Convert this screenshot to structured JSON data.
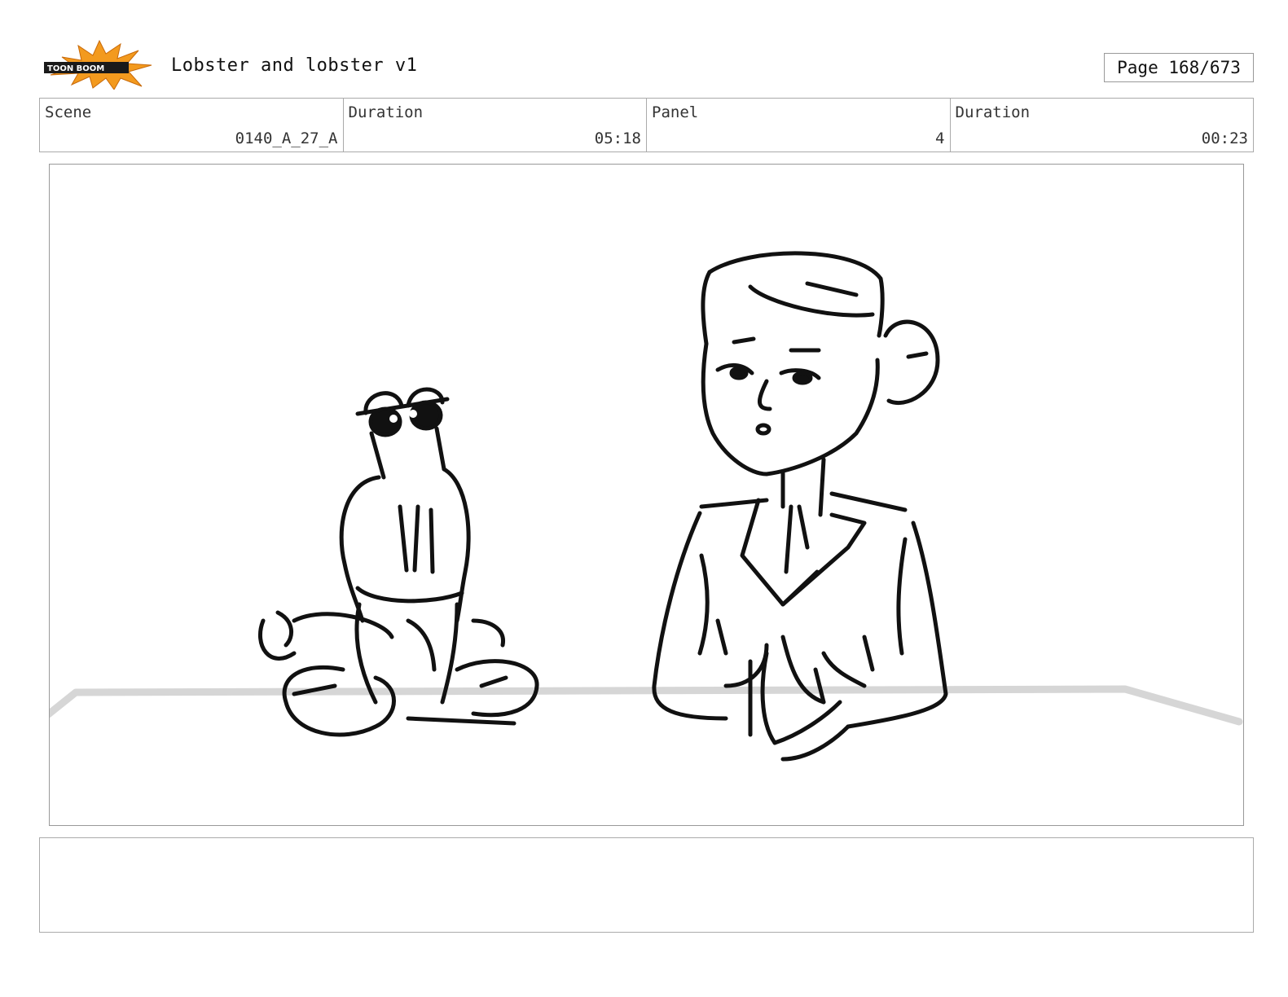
{
  "header": {
    "logo_text": "TOON BOOM",
    "project_title": "Lobster and lobster v1",
    "page_label": "Page 168/673"
  },
  "info": [
    {
      "label": "Scene",
      "value": "0140_A_27_A"
    },
    {
      "label": "Duration",
      "value": "05:18"
    },
    {
      "label": "Panel",
      "value": "4"
    },
    {
      "label": "Duration",
      "value": "00:23"
    }
  ],
  "panel": {
    "drawing": "storyboard-sketch"
  },
  "notes": {
    "text": ""
  },
  "colors": {
    "logo_orange": "#f39a1e",
    "line": "#111111",
    "ground": "#d9d9d9"
  }
}
